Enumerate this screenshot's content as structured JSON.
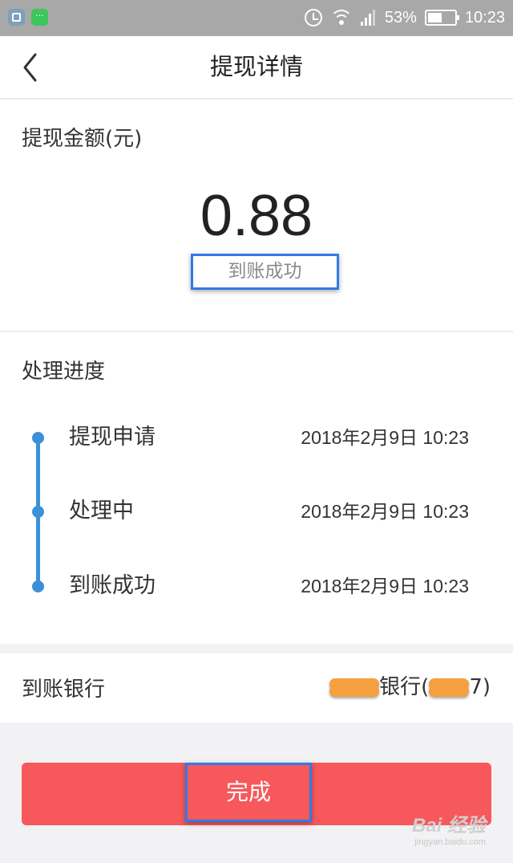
{
  "status_bar": {
    "battery": "53%",
    "battery_level": 0.53,
    "time": "10:23",
    "icons": [
      "gallery-icon",
      "message-icon",
      "alarm-icon",
      "wifi-icon",
      "signal-icon",
      "battery-icon"
    ]
  },
  "header": {
    "title": "提现详情",
    "back_icon": "chevron-left-icon"
  },
  "amount": {
    "label": "提现金额(元)",
    "value": "0.88",
    "status": "到账成功"
  },
  "progress": {
    "title": "处理进度",
    "steps": [
      {
        "label": "提现申请",
        "time": "2018年2月9日 10:23"
      },
      {
        "label": "处理中",
        "time": "2018年2月9日 10:23"
      },
      {
        "label": "到账成功",
        "time": "2018年2月9日 10:23"
      }
    ]
  },
  "bank": {
    "label": "到账银行",
    "value_prefix": "银行(",
    "value_suffix": "7)"
  },
  "actions": {
    "done_label": "完成"
  },
  "watermark": {
    "main": "Bai 经验",
    "sub": "jingyan.baidu.com"
  },
  "colors": {
    "accent_blue": "#3a91d8",
    "button_red": "#f7585c",
    "highlight_box": "#2f7be8"
  }
}
